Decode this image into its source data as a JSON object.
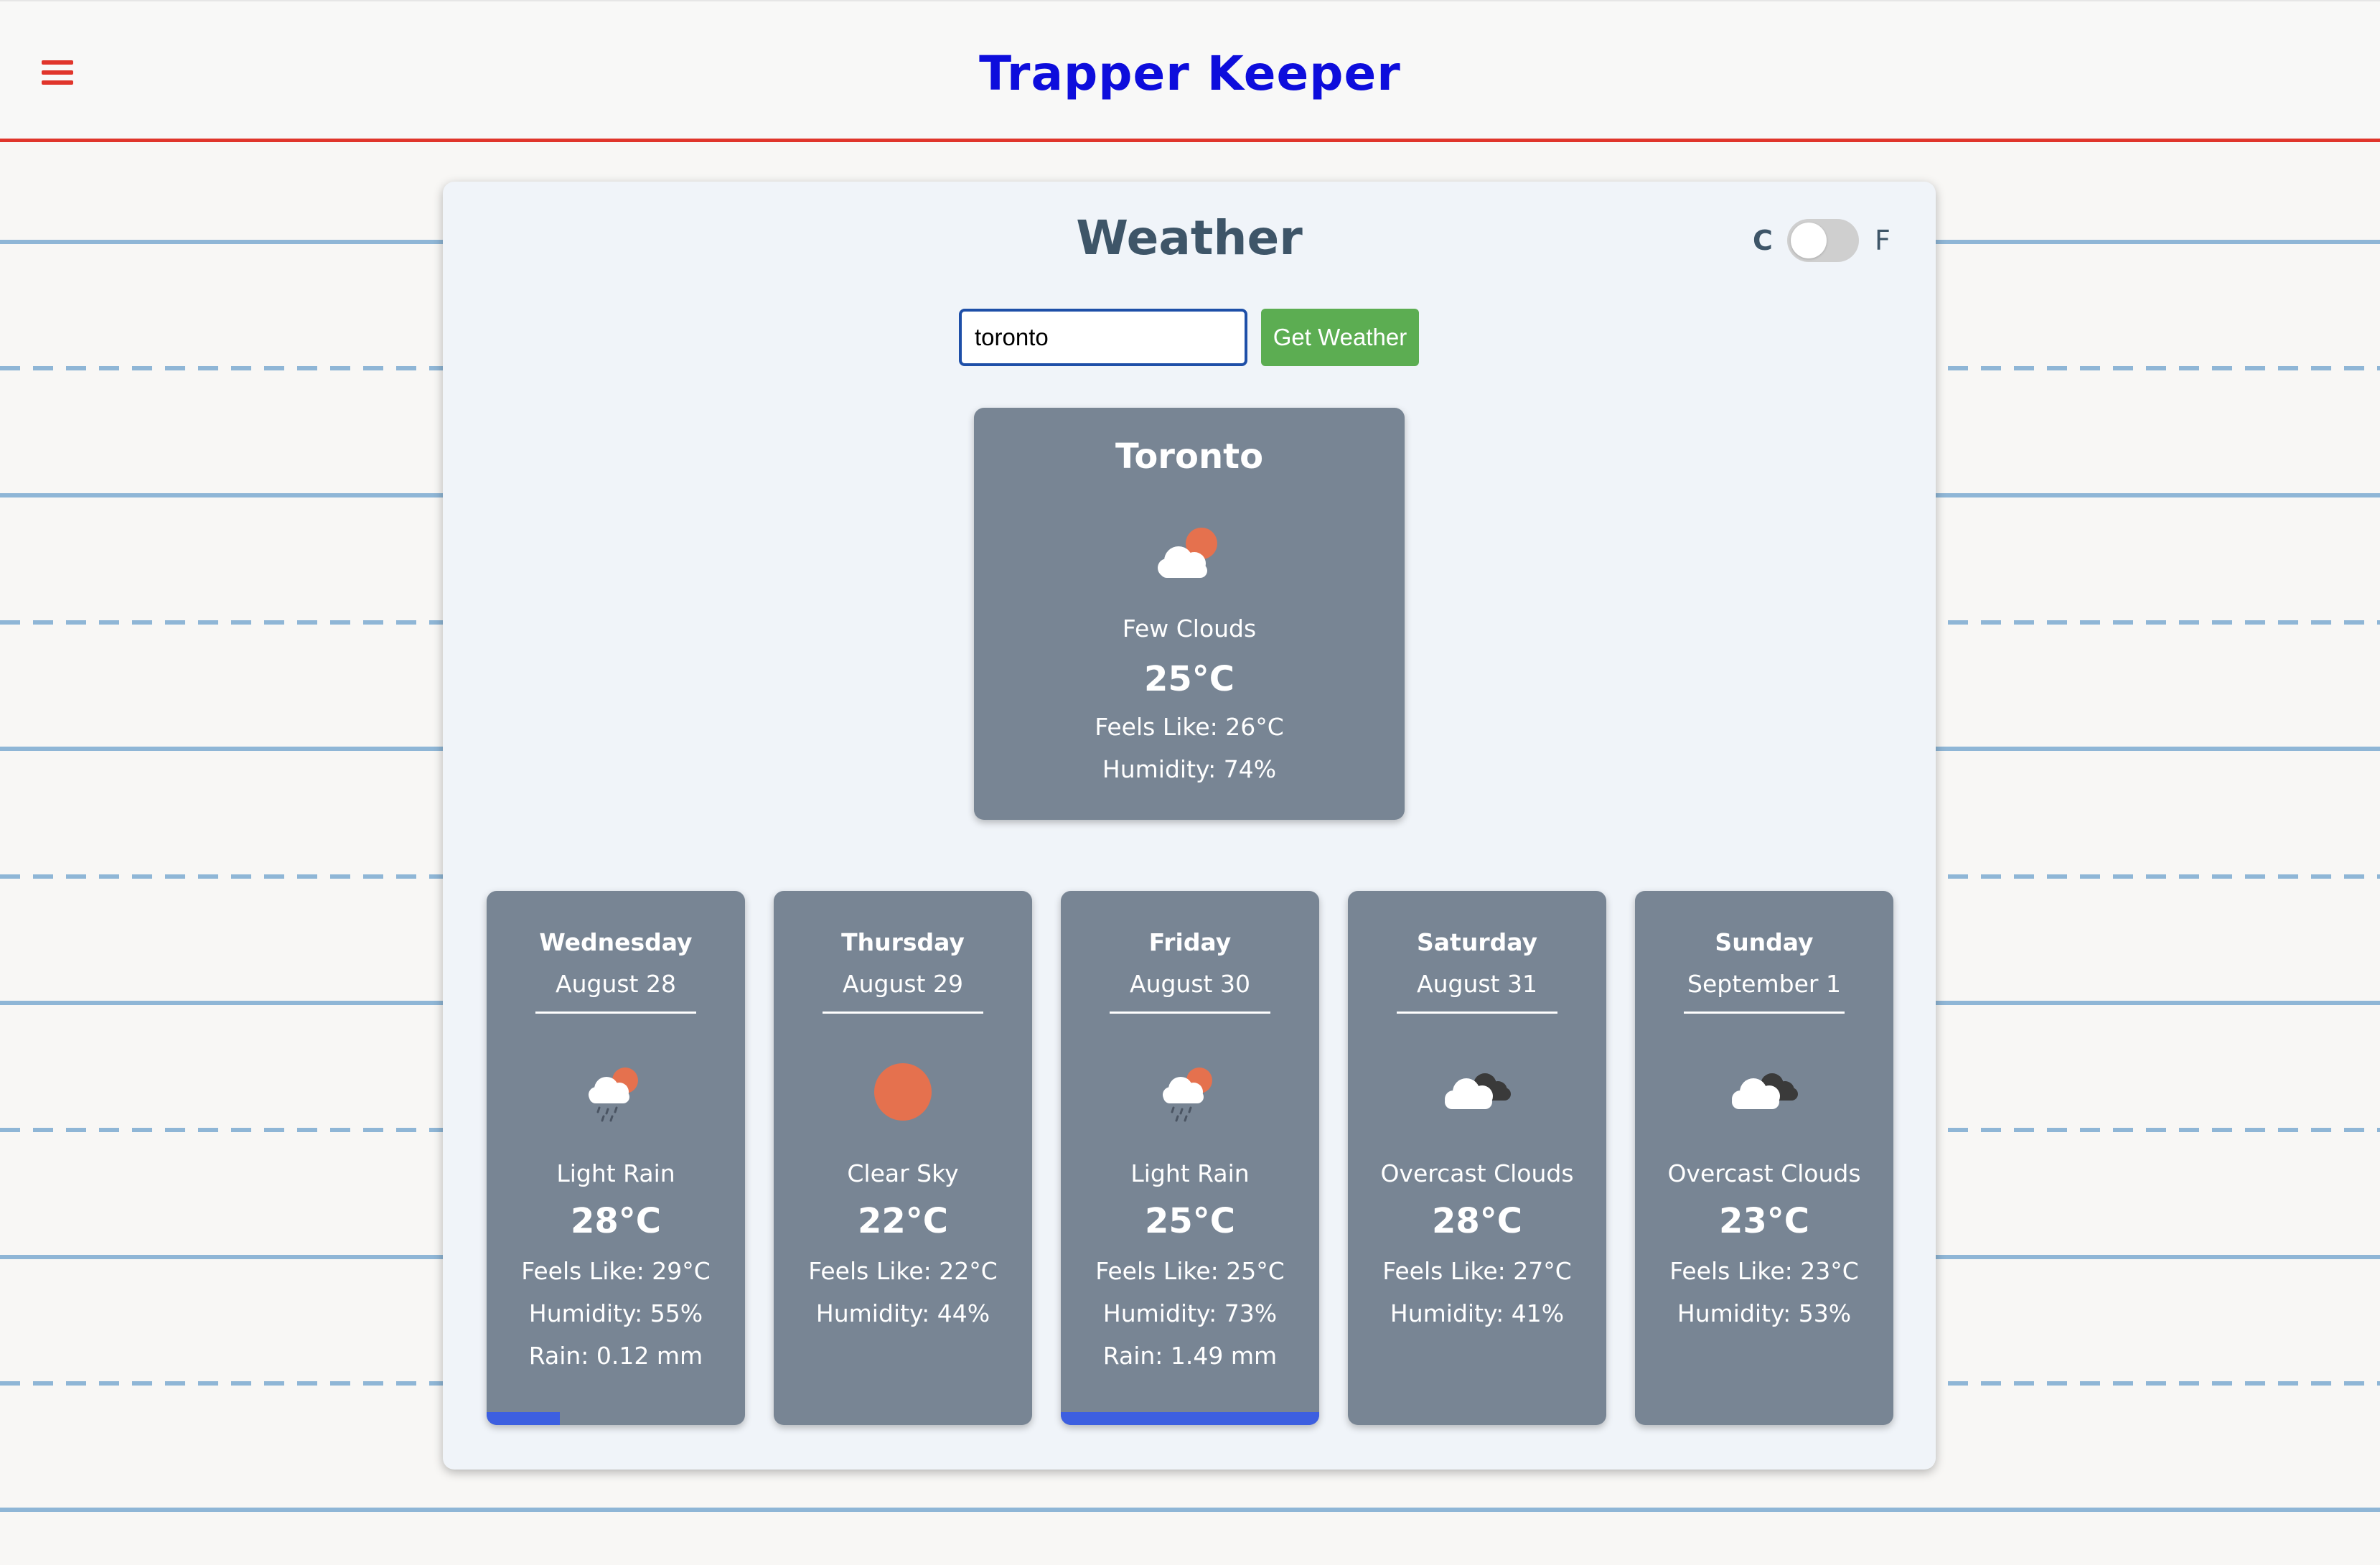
{
  "app": {
    "title": "Trapper Keeper"
  },
  "colors": {
    "accent_red": "#e0352b",
    "title_blue": "#0d0ddc",
    "button_green": "#5cad52",
    "card_gray": "#788594",
    "rain_bar": "#3d5fe0"
  },
  "weather": {
    "title": "Weather",
    "unit_c": "C",
    "unit_f": "F",
    "unit_selected": "C",
    "search": {
      "value": "toronto",
      "button_label": "Get Weather"
    },
    "current": {
      "city": "Toronto",
      "icon": "few-clouds-icon",
      "description": "Few Clouds",
      "temp": "25°C",
      "feels_like": "Feels Like: 26°C",
      "humidity": "Humidity: 74%"
    },
    "forecast": [
      {
        "day": "Wednesday",
        "date": "August 28",
        "icon": "light-rain-icon",
        "description": "Light Rain",
        "temp": "28°C",
        "feels_like": "Feels Like: 29°C",
        "humidity": "Humidity: 55%",
        "rain": "Rain: 0.12 mm",
        "rain_mm": 0.12
      },
      {
        "day": "Thursday",
        "date": "August 29",
        "icon": "clear-sky-icon",
        "description": "Clear Sky",
        "temp": "22°C",
        "feels_like": "Feels Like: 22°C",
        "humidity": "Humidity: 44%"
      },
      {
        "day": "Friday",
        "date": "August 30",
        "icon": "light-rain-icon",
        "description": "Light Rain",
        "temp": "25°C",
        "feels_like": "Feels Like: 25°C",
        "humidity": "Humidity: 73%",
        "rain": "Rain: 1.49 mm",
        "rain_mm": 1.49
      },
      {
        "day": "Saturday",
        "date": "August 31",
        "icon": "overcast-clouds-icon",
        "description": "Overcast Clouds",
        "temp": "28°C",
        "feels_like": "Feels Like: 27°C",
        "humidity": "Humidity: 41%"
      },
      {
        "day": "Sunday",
        "date": "September 1",
        "icon": "overcast-clouds-icon",
        "description": "Overcast Clouds",
        "temp": "23°C",
        "feels_like": "Feels Like: 23°C",
        "humidity": "Humidity: 53%"
      }
    ]
  }
}
